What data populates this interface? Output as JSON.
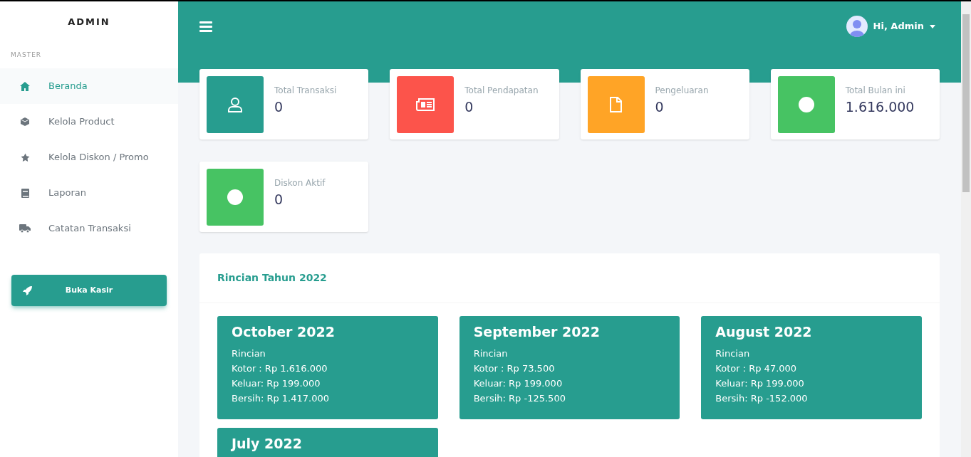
{
  "sidebar": {
    "brand": "ADMIN",
    "section": "MASTER",
    "items": [
      {
        "label": "Beranda",
        "selected": true
      },
      {
        "label": "Kelola Product",
        "selected": false
      },
      {
        "label": "Kelola Diskon / Promo",
        "selected": false
      },
      {
        "label": "Laporan",
        "selected": false
      },
      {
        "label": "Catatan Transaksi",
        "selected": false
      }
    ],
    "button": "Buka Kasir"
  },
  "topbar": {
    "user": "Hi, Admin"
  },
  "stats": [
    {
      "label": "Total Transaksi",
      "value": "0",
      "color": "#279d8f"
    },
    {
      "label": "Total Pendapatan",
      "value": "0",
      "color": "#fc544b"
    },
    {
      "label": "Pengeluaran",
      "value": "0",
      "color": "#ffa426"
    },
    {
      "label": "Total Bulan ini",
      "value": "1.616.000",
      "color": "#47c363"
    },
    {
      "label": "Diskon Aktif",
      "value": "0",
      "color": "#47c363"
    }
  ],
  "summary": {
    "title": "Rincian Tahun 2022",
    "months": [
      {
        "title": "October 2022",
        "lines": [
          "Rincian",
          "Kotor : Rp 1.616.000",
          "Keluar: Rp 199.000",
          "Bersih: Rp 1.417.000"
        ]
      },
      {
        "title": "September 2022",
        "lines": [
          "Rincian",
          "Kotor : Rp 73.500",
          "Keluar: Rp 199.000",
          "Bersih: Rp -125.500"
        ]
      },
      {
        "title": "August 2022",
        "lines": [
          "Rincian",
          "Kotor : Rp 47.000",
          "Keluar: Rp 199.000",
          "Bersih: Rp -152.000"
        ]
      },
      {
        "title": "July 2022"
      }
    ]
  }
}
